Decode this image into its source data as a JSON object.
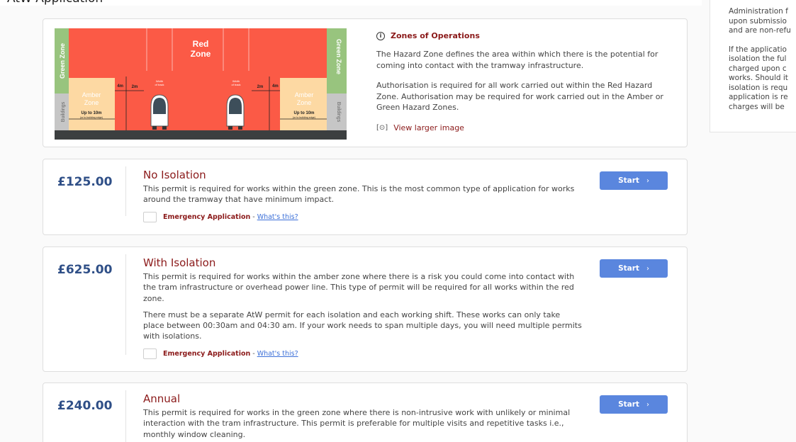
{
  "header": {
    "title": "AtW Application"
  },
  "sidebar": {
    "lines_1": [
      "Administration f",
      "upon submissio",
      "and are non-refu"
    ],
    "lines_2": [
      "If the applicatio",
      "isolation the ful",
      "charged upon c",
      "works. Should it",
      "isolation is requ",
      "application is re",
      "charges will be"
    ]
  },
  "zones": {
    "title": "Zones of Operations",
    "para1": "The Hazard Zone defines the area within which there is the potential for coming into contact with the tramway infrastructure.",
    "para2": "Authorisation is required for all work carried out within the Red Hazard Zone. Authorisation may be required for work carried out in the Amber or Green Hazard Zones.",
    "link": "View larger image",
    "diagram": {
      "red_zone_line1": "Red",
      "red_zone_line2": "Zone",
      "green_zone": "Green Zone",
      "buildings": "Buildings",
      "amber_line1": "Amber",
      "amber_line2": "Zone",
      "up_to": "Up to 10m",
      "building_edge": "(or to building edge)",
      "four_m": "4m",
      "two_m": "2m",
      "width_line1": "Width",
      "width_line2": "of track"
    },
    "colors": {
      "red": "#fb5a46",
      "amber": "#fdd9a3",
      "green": "#98c47e",
      "buildings": "#c6c6c6",
      "ground": "#3c3f40"
    }
  },
  "permits": [
    {
      "price": "£125.00",
      "title": "No Isolation",
      "desc": "This permit is required for works within the green zone. This is the most common type of application for works around the tramway that have minimum impact.",
      "emergency_label": "Emergency Application",
      "separator": "-",
      "whats_this": "What's this?",
      "start": "Start"
    },
    {
      "price": "£625.00",
      "title": "With Isolation",
      "desc": "This permit is required for works within the amber zone where there is a risk you could come into contact with the tram infrastructure or overhead power line. This type of permit will be required for all works within the red zone.",
      "desc2": "There must be a separate AtW permit for each isolation and each working shift. These works can only take place between 00:30am and 04:30 am. If your work needs to span multiple days, you will need multiple permits with isolations.",
      "emergency_label": "Emergency Application",
      "separator": "-",
      "whats_this": "What's this?",
      "start": "Start"
    },
    {
      "price": "£240.00",
      "title": "Annual",
      "desc": "This permit is required for works in the green zone where there is non-intrusive work with unlikely or minimal interaction with the tram infrastructure. This permit is preferable for multiple visits and repetitive tasks i.e., monthly window cleaning.",
      "start": "Start"
    }
  ],
  "theme": {
    "accent": "#5a86de",
    "title_red": "#8b1a1a",
    "price_blue": "#2f4f87",
    "link_blue": "#3b6fd8"
  }
}
